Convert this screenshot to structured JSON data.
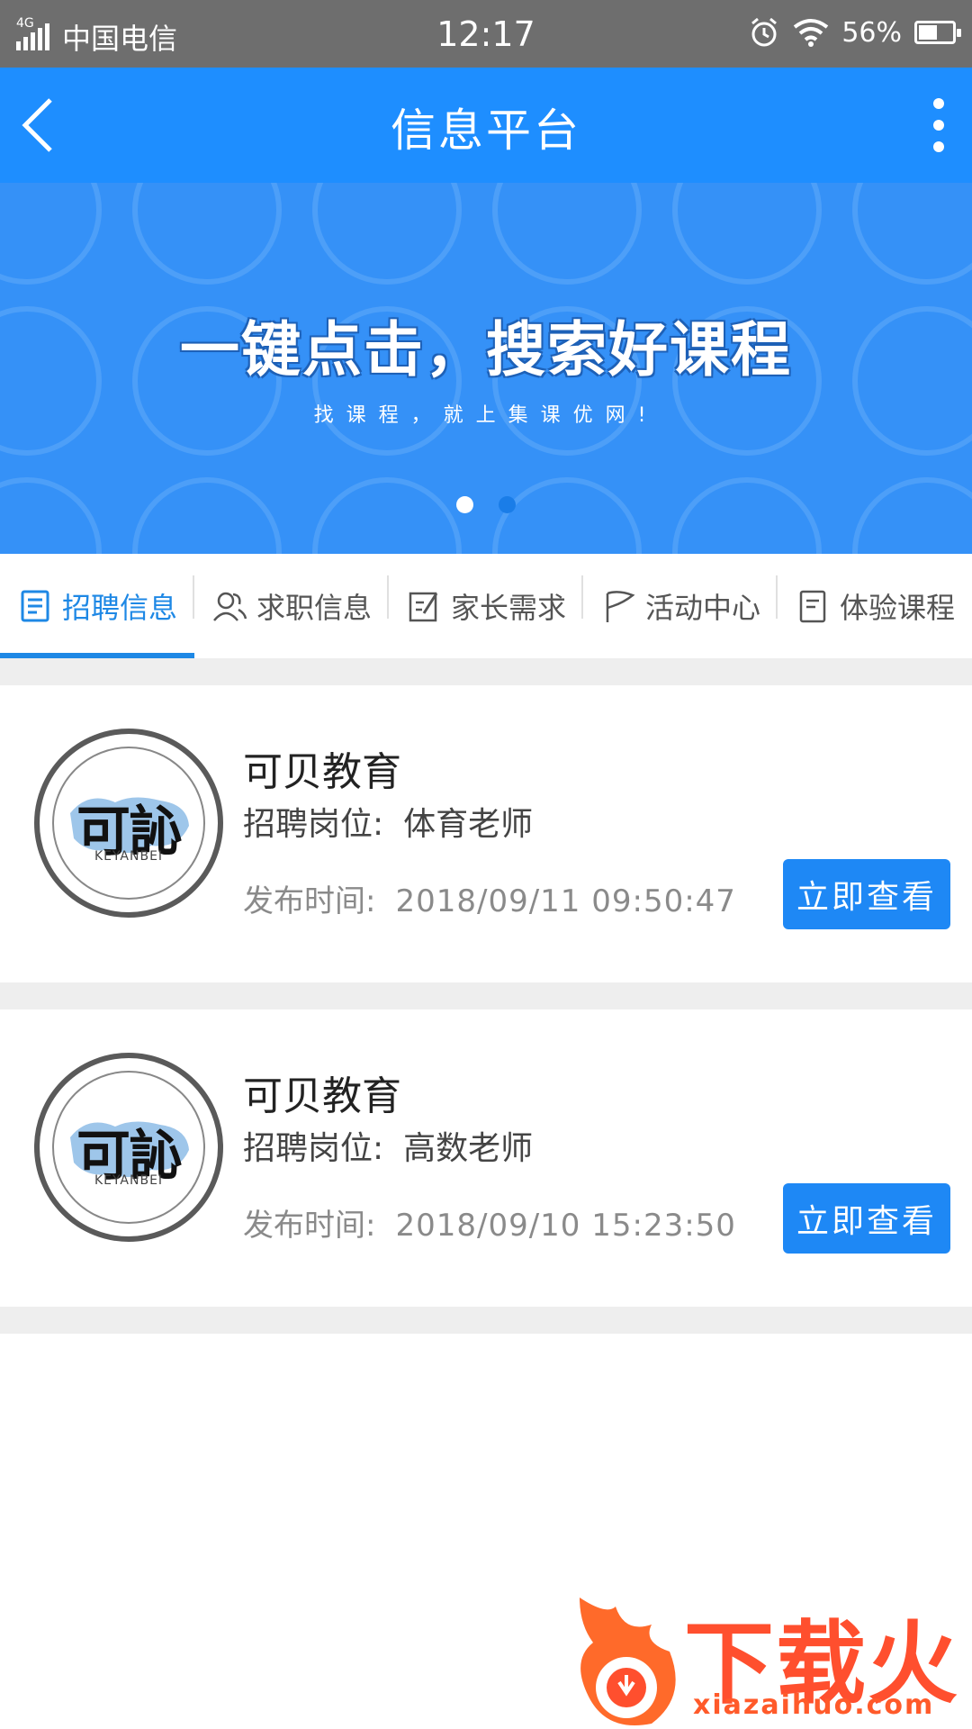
{
  "status_bar": {
    "network": "4G",
    "carrier": "中国电信",
    "time": "12:17",
    "battery": "56%",
    "battery_level": 0.56
  },
  "header": {
    "title": "信息平台"
  },
  "banner": {
    "headline": "一键点击，搜索好课程",
    "subtitle": "找课程，就上集课优网!",
    "slide_count": 2,
    "active_slide": 1
  },
  "tabs": [
    {
      "label": "招聘信息",
      "icon": "document-icon",
      "active": true
    },
    {
      "label": "求职信息",
      "icon": "users-icon",
      "active": false
    },
    {
      "label": "家长需求",
      "icon": "edit-icon",
      "active": false
    },
    {
      "label": "活动中心",
      "icon": "flag-icon",
      "active": false
    },
    {
      "label": "体验课程",
      "icon": "clipboard-icon",
      "active": false
    }
  ],
  "jobs": [
    {
      "company": "可贝教育",
      "position_label": "招聘岗位:",
      "position": "体育老师",
      "time_label": "发布时间:",
      "time": "2018/09/11 09:50:47",
      "button": "立即查看",
      "logo_mark": "可訫",
      "logo_brand": "KEYANBEI"
    },
    {
      "company": "可贝教育",
      "position_label": "招聘岗位:",
      "position": "高数老师",
      "time_label": "发布时间:",
      "time": "2018/09/10 15:23:50",
      "button": "立即查看",
      "logo_mark": "可訫",
      "logo_brand": "KEYANBEI"
    }
  ],
  "watermark": {
    "brand": "下载火",
    "url": "xiazaihuo.com"
  },
  "colors": {
    "primary": "#1e8eff",
    "banner": "#3591f7",
    "watermark": "#ff4f2e"
  }
}
